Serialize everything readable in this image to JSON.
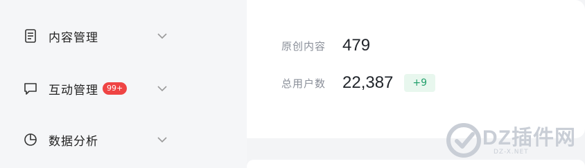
{
  "sidebar": {
    "items": [
      {
        "label": "内容管理",
        "icon": "document-icon"
      },
      {
        "label": "互动管理",
        "icon": "message-icon",
        "badge": "99+"
      },
      {
        "label": "数据分析",
        "icon": "pie-chart-icon"
      }
    ]
  },
  "stats": {
    "original_content": {
      "label": "原创内容",
      "value": "479"
    },
    "total_users": {
      "label": "总用户数",
      "value": "22,387",
      "delta": "+9"
    }
  },
  "colors": {
    "badge": "#ef4444",
    "delta_bg": "#e8f7ee",
    "delta_text": "#22a06b"
  },
  "watermark": {
    "brand": "DZ插件网",
    "domain": "DZ-X.NET"
  }
}
